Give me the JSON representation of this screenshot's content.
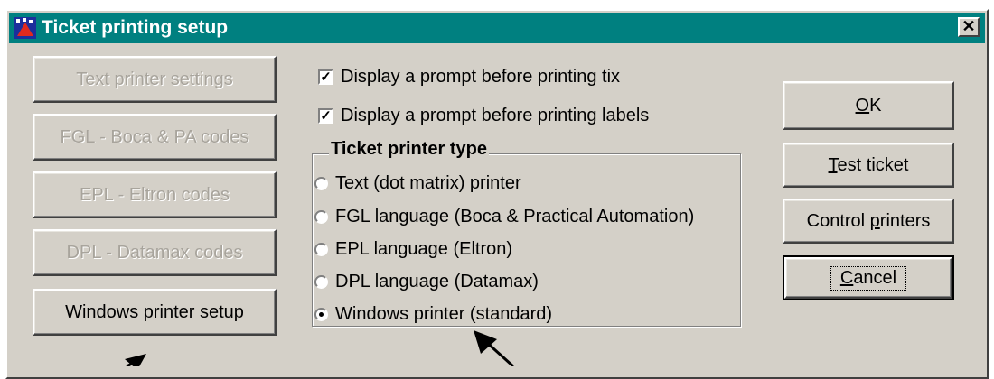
{
  "window": {
    "title": "Ticket printing setup",
    "close_label": "✕"
  },
  "left_buttons": [
    {
      "label": "Text printer settings",
      "disabled": true
    },
    {
      "label": "FGL - Boca & PA codes",
      "disabled": true
    },
    {
      "label": "EPL - Eltron codes",
      "disabled": true
    },
    {
      "label": "DPL - Datamax codes",
      "disabled": true
    },
    {
      "label": "Windows printer setup",
      "disabled": false
    }
  ],
  "checkboxes": [
    {
      "label": "Display a prompt before printing tix",
      "checked": true
    },
    {
      "label": "Display a prompt before printing labels",
      "checked": true
    }
  ],
  "printer_type": {
    "title": "Ticket printer type",
    "options": [
      {
        "label": "Text (dot matrix) printer",
        "selected": false
      },
      {
        "label": "FGL language (Boca & Practical Automation)",
        "selected": false
      },
      {
        "label": "EPL language (Eltron)",
        "selected": false
      },
      {
        "label": "DPL language (Datamax)",
        "selected": false
      },
      {
        "label": "Windows printer (standard)",
        "selected": true
      }
    ]
  },
  "right_buttons": {
    "ok": {
      "prefix": "",
      "mnemonic": "O",
      "suffix": "K"
    },
    "test": {
      "prefix": "",
      "mnemonic": "T",
      "suffix": "est ticket"
    },
    "control": {
      "prefix": "Control ",
      "mnemonic": "p",
      "suffix": "rinters"
    },
    "cancel": {
      "prefix": "",
      "mnemonic": "C",
      "suffix": "ancel"
    }
  },
  "colors": {
    "titlebar": "#008080",
    "dialog": "#d4d0c8"
  }
}
